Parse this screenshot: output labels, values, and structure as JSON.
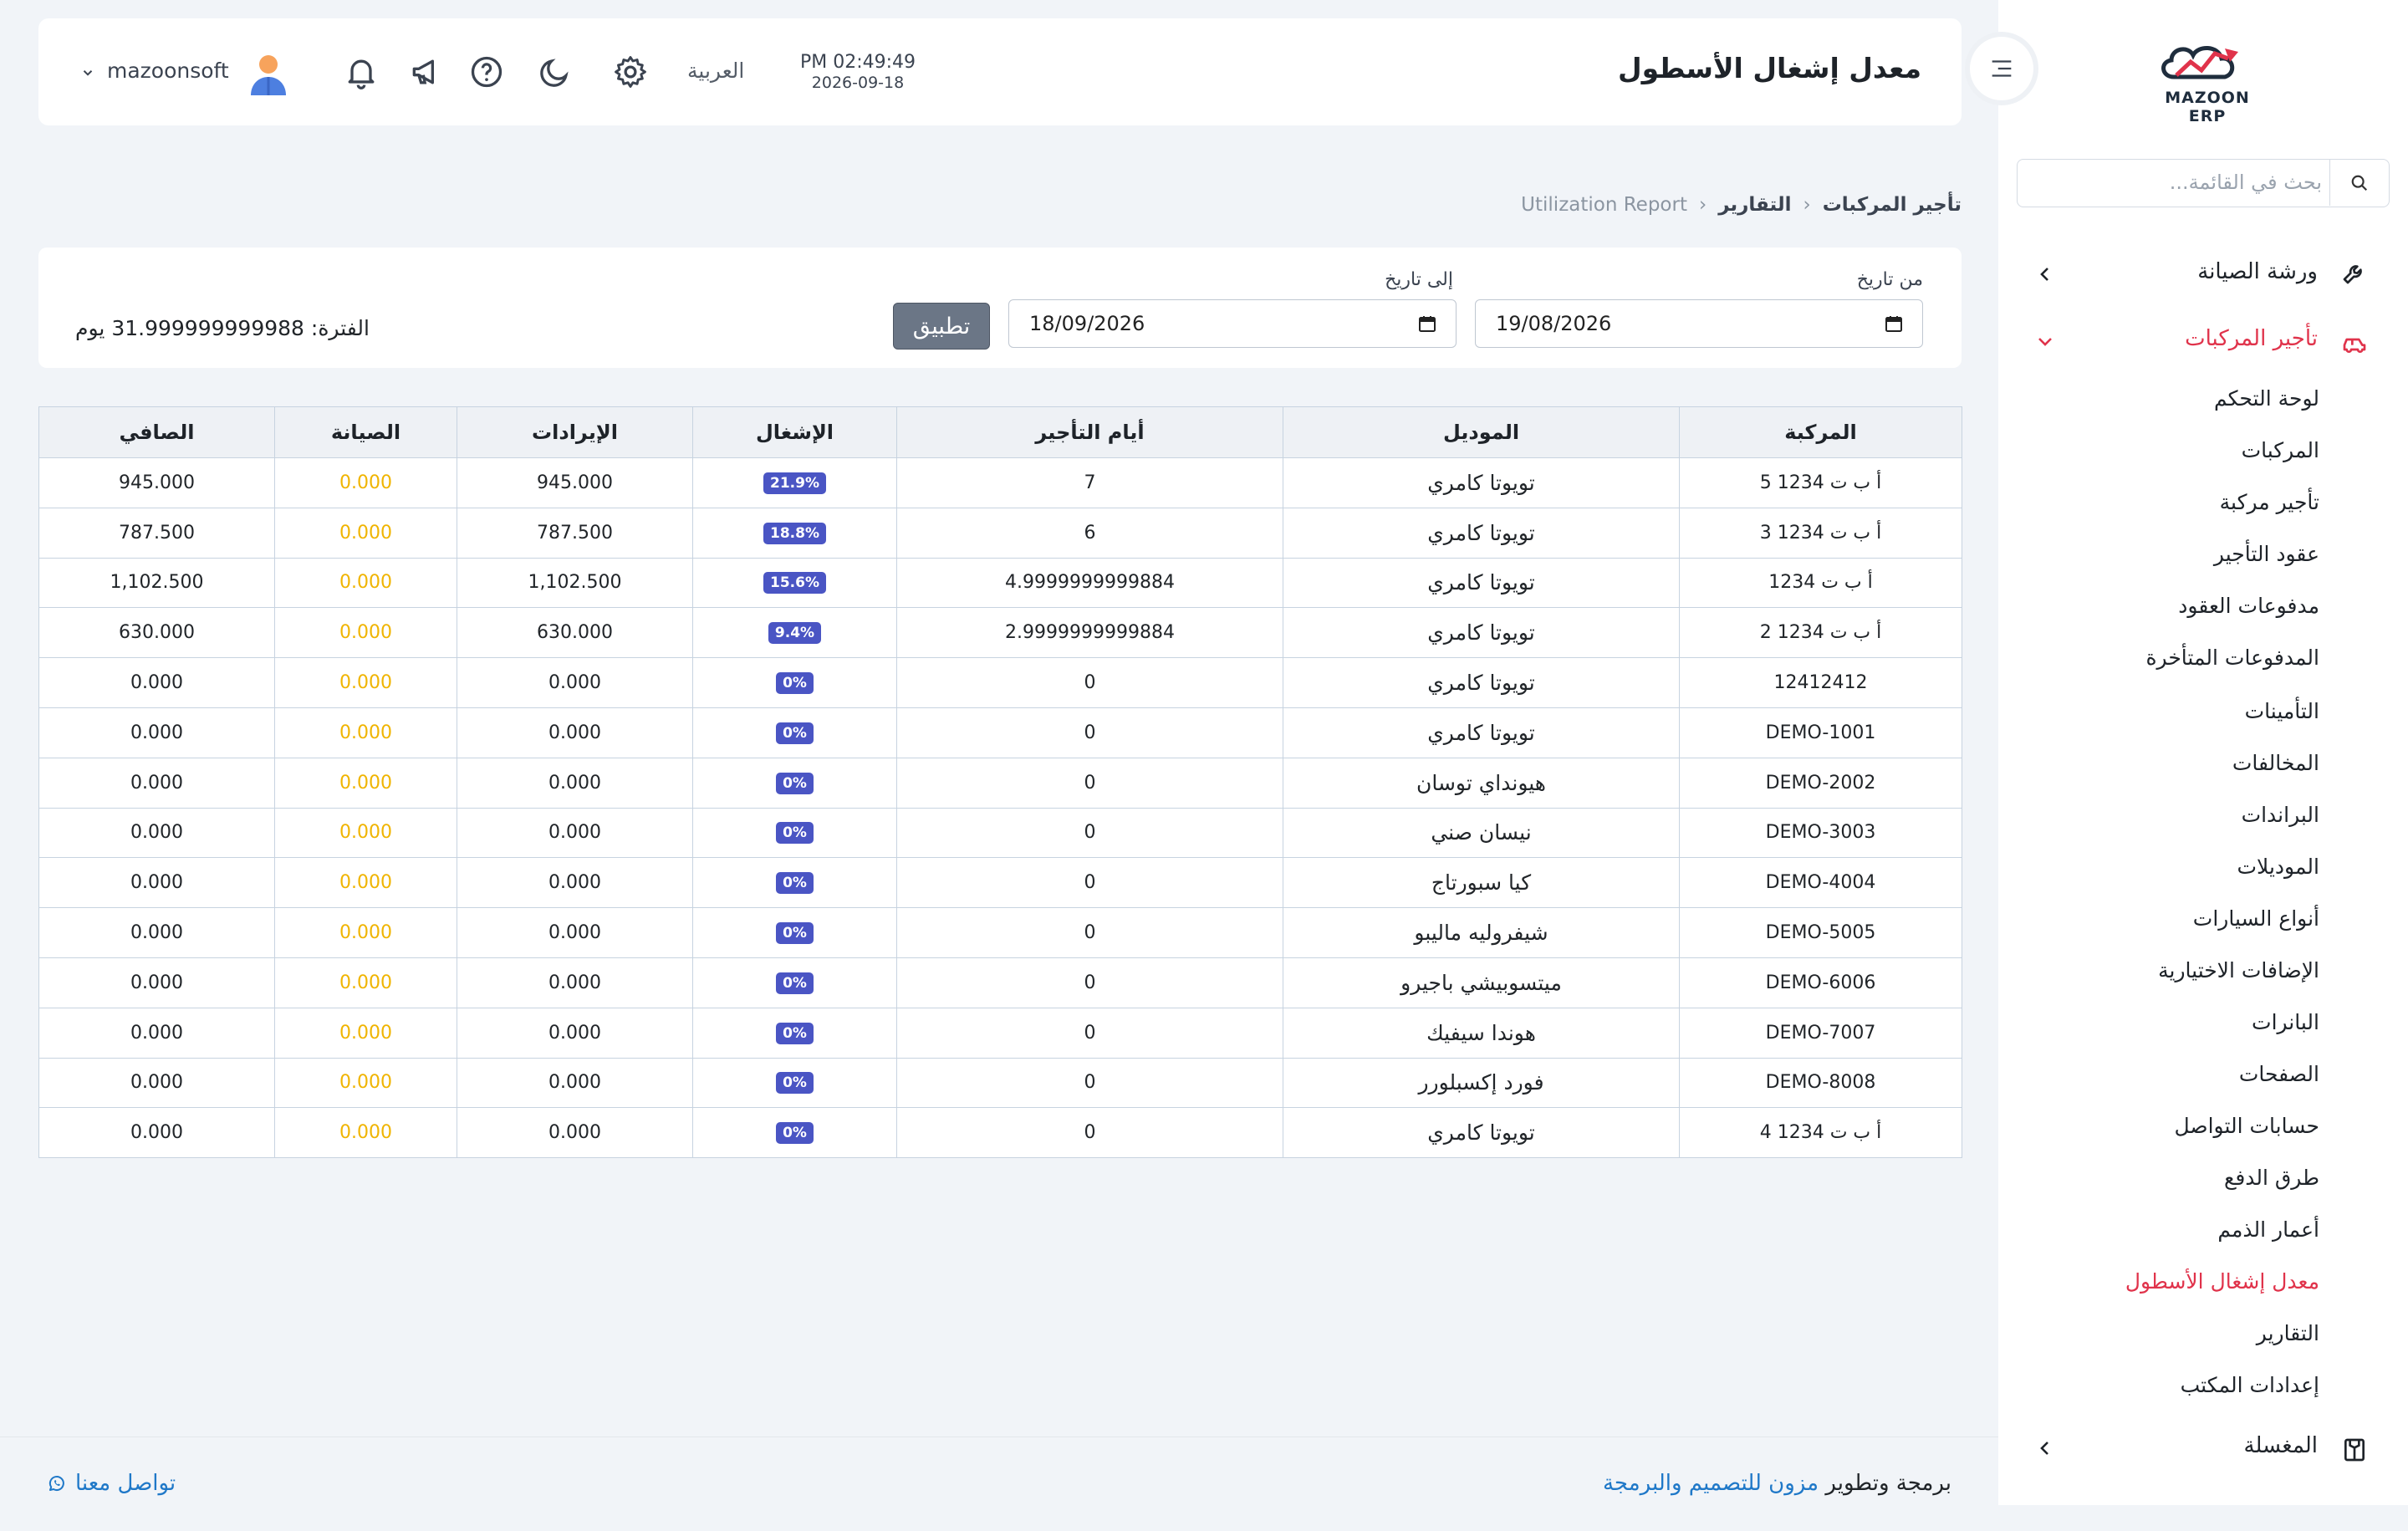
{
  "brand": {
    "logo_text": "MAZOON ERP",
    "logo_subtext": "ERP"
  },
  "sidebar": {
    "search_placeholder": "بحث في القائمة...",
    "groups": [
      {
        "label": "ورشة الصيانة",
        "icon": "wrench-icon"
      },
      {
        "label": "تأجير المركبات",
        "icon": "car-icon"
      },
      {
        "label": "المغسلة",
        "icon": "laundry-icon"
      }
    ],
    "items": [
      "لوحة التحكم",
      "المركبات",
      "تأجير مركبة",
      "عقود التأجير",
      "مدفوعات العقود",
      "المدفوعات المتأخرة",
      "التأمينات",
      "المخالفات",
      "البراندات",
      "الموديلات",
      "أنواع السيارات",
      "الإضافات الاختيارية",
      "البانرات",
      "الصفحات",
      "حسابات التواصل",
      "طرق الدفع",
      "أعمار الذمم",
      "معدل إشغال الأسطول",
      "التقارير",
      "إعدادات المكتب"
    ],
    "active_item": "معدل إشغال الأسطول"
  },
  "header": {
    "title": "معدل إشغال الأسطول",
    "time": "PM 02:49:49",
    "date": "2026-09-18",
    "language": "العربية",
    "username": "mazoonsoft"
  },
  "breadcrumb": {
    "root": "تأجير المركبات",
    "section": "التقارير",
    "current": "Utilization Report"
  },
  "filter": {
    "from_label": "من تاريخ",
    "from_value": "19/08/2026",
    "to_label": "إلى تاريخ",
    "to_value": "18/09/2026",
    "apply_label": "تطبيق",
    "period_text": "الفترة: 31.999999999988 يوم"
  },
  "table": {
    "columns": [
      "المركبة",
      "الموديل",
      "أيام التأجير",
      "الإشغال",
      "الإيرادات",
      "الصيانة",
      "الصافي"
    ],
    "rows": [
      [
        "أ ب ت 1234 5",
        "تويوتا كامري",
        "7",
        "21.9%",
        "945.000",
        "0.000",
        "945.000"
      ],
      [
        "أ ب ت 1234 3",
        "تويوتا كامري",
        "6",
        "18.8%",
        "787.500",
        "0.000",
        "787.500"
      ],
      [
        "أ ب ت 1234",
        "تويوتا كامري",
        "4.9999999999884",
        "15.6%",
        "1,102.500",
        "0.000",
        "1,102.500"
      ],
      [
        "أ ب ت 1234 2",
        "تويوتا كامري",
        "2.9999999999884",
        "9.4%",
        "630.000",
        "0.000",
        "630.000"
      ],
      [
        "12412412",
        "تويوتا كامري",
        "0",
        "0%",
        "0.000",
        "0.000",
        "0.000"
      ],
      [
        "DEMO-1001",
        "تويوتا كامري",
        "0",
        "0%",
        "0.000",
        "0.000",
        "0.000"
      ],
      [
        "DEMO-2002",
        "هيونداي توسان",
        "0",
        "0%",
        "0.000",
        "0.000",
        "0.000"
      ],
      [
        "DEMO-3003",
        "نيسان صني",
        "0",
        "0%",
        "0.000",
        "0.000",
        "0.000"
      ],
      [
        "DEMO-4004",
        "كيا سبورتاج",
        "0",
        "0%",
        "0.000",
        "0.000",
        "0.000"
      ],
      [
        "DEMO-5005",
        "شيفروليه ماليبو",
        "0",
        "0%",
        "0.000",
        "0.000",
        "0.000"
      ],
      [
        "DEMO-6006",
        "ميتسوبيشي باجيرو",
        "0",
        "0%",
        "0.000",
        "0.000",
        "0.000"
      ],
      [
        "DEMO-7007",
        "هوندا سيفيك",
        "0",
        "0%",
        "0.000",
        "0.000",
        "0.000"
      ],
      [
        "DEMO-8008",
        "فورد إكسبلورر",
        "0",
        "0%",
        "0.000",
        "0.000",
        "0.000"
      ],
      [
        "أ ب ت 1234 4",
        "تويوتا كامري",
        "0",
        "0%",
        "0.000",
        "0.000",
        "0.000"
      ]
    ]
  },
  "footer": {
    "credit_prefix": "برمجة وتطوير",
    "company": "مزون للتصميم والبرمجة",
    "contact": "تواصل معنا"
  },
  "colors": {
    "accent": "#e0334b",
    "link": "#1f78c8",
    "badge": "#4a55c4",
    "maintenance": "#f0b400"
  }
}
